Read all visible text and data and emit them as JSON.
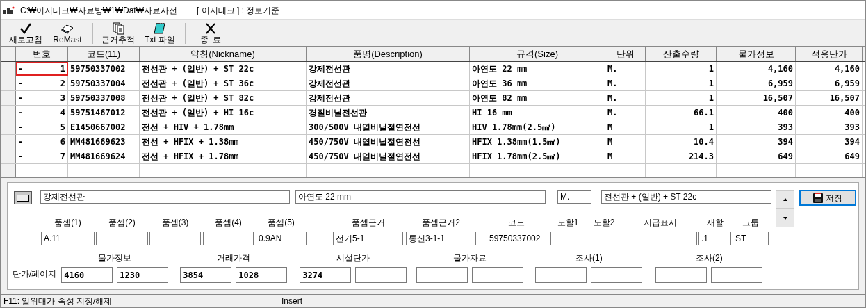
{
  "title_bar": {
    "path": "C:₩이지테크₩자료방₩1₩Dat₩자료사전",
    "company": "[ 이지테크 ] : 정보기준"
  },
  "toolbar": [
    {
      "label": "새로고침"
    },
    {
      "label": "ReMast"
    },
    {
      "label": "근거추적"
    },
    {
      "label": "Txt 파일"
    },
    {
      "label": "종  료"
    }
  ],
  "grid": {
    "columns": [
      {
        "label": "번호",
        "kind": "number"
      },
      {
        "label": "코드(11)",
        "kind": "text"
      },
      {
        "label": "약칭(Nickname)",
        "kind": "text"
      },
      {
        "label": "품명(Description)",
        "kind": "text"
      },
      {
        "label": "규격(Size)",
        "kind": "text"
      },
      {
        "label": "단위",
        "kind": "text"
      },
      {
        "label": "산출수량",
        "kind": "number"
      },
      {
        "label": "물가정보",
        "kind": "number"
      },
      {
        "label": "적용단가",
        "kind": "number"
      }
    ],
    "rows": [
      {
        "focused": true,
        "marker": "-",
        "cells": [
          "1",
          "59750337002",
          "전선관 + (일반) + ST 22c",
          "강제전선관",
          "아연도 22 mm",
          "M.",
          "1",
          "4,160",
          "4,160"
        ]
      },
      {
        "focused": false,
        "marker": "-",
        "cells": [
          "2",
          "59750337004",
          "전선관 + (일반) + ST 36c",
          "강제전선관",
          "아연도 36 mm",
          "M.",
          "1",
          "6,959",
          "6,959"
        ]
      },
      {
        "focused": false,
        "marker": "-",
        "cells": [
          "3",
          "59750337008",
          "전선관 + (일반) + ST 82c",
          "강제전선관",
          "아연도 82 mm",
          "M.",
          "1",
          "16,507",
          "16,507"
        ]
      },
      {
        "focused": false,
        "marker": "-",
        "cells": [
          "4",
          "59751467012",
          "전선관 + (일반) + HI 16c",
          "경질비닐전선관",
          "HI 16 mm",
          "M.",
          "66.1",
          "400",
          "400"
        ]
      },
      {
        "focused": false,
        "marker": "-",
        "cells": [
          "5",
          "E1450667002",
          "전선 + HIV + 1.78mm",
          "300/500V 내열비닐절연전선",
          "HIV 1.78mm(2.5㎟)",
          "M",
          "1",
          "393",
          "393"
        ]
      },
      {
        "focused": false,
        "marker": "-",
        "cells": [
          "6",
          "MM481669623",
          "전선 + HFIX + 1.38mm",
          "450/750V 내열비닐절연전선",
          "HFIX 1.38mm(1.5㎟)",
          "M",
          "10.4",
          "394",
          "394"
        ]
      },
      {
        "focused": false,
        "marker": "-",
        "cells": [
          "7",
          "MM481669624",
          "전선 + HFIX + 1.78mm",
          "450/750V 내열비닐절연전선",
          "HFIX 1.78mm(2.5㎟)",
          "M",
          "214.3",
          "649",
          "649"
        ]
      }
    ]
  },
  "detail": {
    "name": "강제전선관",
    "size": "아연도 22 mm",
    "unit": "M.",
    "nickname": "전선관 + (일반) + ST 22c",
    "save_button": "저장",
    "fields": [
      {
        "label": "품셈(1)",
        "value": "A.11"
      },
      {
        "label": "품셈(2)"
      },
      {
        "label": "품셈(3)"
      },
      {
        "label": "품셈(4)"
      },
      {
        "label": "품셈(5)",
        "value": "0.9AN"
      },
      {
        "label": "품셈근거",
        "value": "전기5-1"
      },
      {
        "label": "품셈근거2",
        "value": "통신3-1-1"
      },
      {
        "label": "코드",
        "value": "59750337002"
      },
      {
        "label": "노할1"
      },
      {
        "label": "노할2"
      },
      {
        "label": "지급표시"
      },
      {
        "label": "재할",
        "value": ".1"
      },
      {
        "label": "그룹",
        "value": "ST"
      }
    ],
    "price_label": "단가/페이지",
    "price_groups": [
      {
        "label": "물가정보",
        "values": [
          "4160",
          "1230"
        ]
      },
      {
        "label": "거래가격",
        "values": [
          "3854",
          "1028"
        ]
      },
      {
        "label": "시설단가",
        "values": [
          "3274"
        ]
      },
      {
        "label": "물가자료"
      },
      {
        "label": "조사(1)"
      },
      {
        "label": "조사(2)"
      }
    ]
  },
  "status_bar": [
    "F11: 일위대가 속성 지정/해제",
    "Insert"
  ]
}
